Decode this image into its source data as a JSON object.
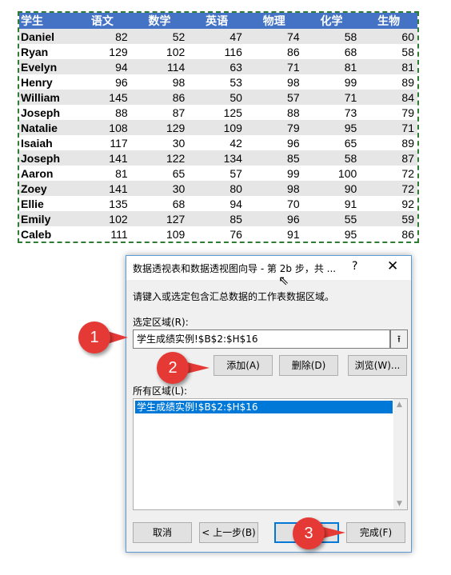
{
  "sheet": {
    "headers": [
      "学生",
      "语文",
      "数学",
      "英语",
      "物理",
      "化学",
      "生物"
    ],
    "rows": [
      [
        "Daniel",
        "82",
        "52",
        "47",
        "74",
        "58",
        "60"
      ],
      [
        "Ryan",
        "129",
        "102",
        "116",
        "86",
        "68",
        "58"
      ],
      [
        "Evelyn",
        "94",
        "114",
        "63",
        "71",
        "81",
        "81"
      ],
      [
        "Henry",
        "96",
        "98",
        "53",
        "98",
        "99",
        "89"
      ],
      [
        "William",
        "145",
        "86",
        "50",
        "57",
        "71",
        "84"
      ],
      [
        "Joseph",
        "88",
        "87",
        "125",
        "88",
        "73",
        "79"
      ],
      [
        "Natalie",
        "108",
        "129",
        "109",
        "79",
        "95",
        "71"
      ],
      [
        "Isaiah",
        "117",
        "30",
        "42",
        "96",
        "65",
        "89"
      ],
      [
        "Joseph",
        "141",
        "122",
        "134",
        "85",
        "58",
        "87"
      ],
      [
        "Aaron",
        "81",
        "65",
        "57",
        "99",
        "100",
        "72"
      ],
      [
        "Zoey",
        "141",
        "30",
        "80",
        "98",
        "90",
        "72"
      ],
      [
        "Ellie",
        "135",
        "68",
        "94",
        "70",
        "91",
        "92"
      ],
      [
        "Emily",
        "102",
        "127",
        "85",
        "96",
        "55",
        "59"
      ],
      [
        "Caleb",
        "111",
        "109",
        "76",
        "91",
        "95",
        "86"
      ]
    ],
    "header_color": "#4472c4",
    "border_color": "#2e7d32"
  },
  "dialog": {
    "title": "数据透视表和数据透视图向导 - 第 2b 步，共 ...",
    "help": "?",
    "close": "✕",
    "instruction": "请键入或选定包含汇总数据的工作表数据区域。",
    "range_label": "选定区域(R):",
    "range_value": "学生成绩实例!$B$2:$H$16",
    "collapse_icon": "⭱",
    "add_label": "添加(A)",
    "delete_label": "删除(D)",
    "browse_label": "浏览(W)...",
    "all_ranges_label": "所有区域(L):",
    "all_ranges": [
      "学生成绩实例!$B$2:$H$16"
    ],
    "cancel_label": "取消",
    "back_label": "< 上一步(B)",
    "next_label": "下一",
    "finish_label": "完成(F)"
  },
  "callouts": [
    "1",
    "2",
    "3"
  ],
  "colors": {
    "callout": "#e53935",
    "selection": "#0078d7"
  }
}
